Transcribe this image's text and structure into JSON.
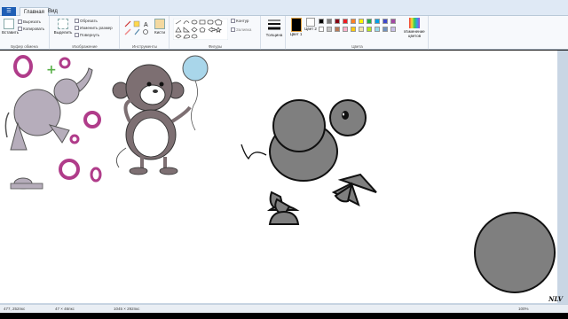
{
  "tabs": {
    "file": "",
    "home": "Главная",
    "view": "Вид"
  },
  "clipboard": {
    "paste": "Вставить",
    "cut": "Вырезать",
    "copy": "Копировать",
    "label": "Буфер обмена"
  },
  "image": {
    "select": "Выделить",
    "crop": "Обрезать",
    "resize": "Изменить размер",
    "rotate": "Повернуть",
    "label": "Изображение"
  },
  "tools": {
    "label": "Инструменты",
    "brushes": "Кисти"
  },
  "shapes": {
    "outline": "Контур",
    "fill": "Заливка",
    "label": "Фигуры"
  },
  "size": {
    "label": "Толщина"
  },
  "colors": {
    "color1": "Цвет 1",
    "color2": "Цвет 2",
    "edit": "Изменение цветов",
    "label": "Цвета",
    "palette": [
      "#000000",
      "#7f7f7f",
      "#880015",
      "#ed1c24",
      "#ff7f27",
      "#fff200",
      "#22b14c",
      "#00a2e8",
      "#3f48cc",
      "#a349a4",
      "#ffffff",
      "#c3c3c3",
      "#b97a57",
      "#ffaec9",
      "#ffc90e",
      "#efe4b0",
      "#b5e61d",
      "#99d9ea",
      "#7092be",
      "#c8bfe7"
    ]
  },
  "status": {
    "pos": "477, 252пкс",
    "sel": "47 × 46пкс",
    "size": "1045 × 292пкс",
    "zoom": "100%"
  },
  "signature": "NLV"
}
